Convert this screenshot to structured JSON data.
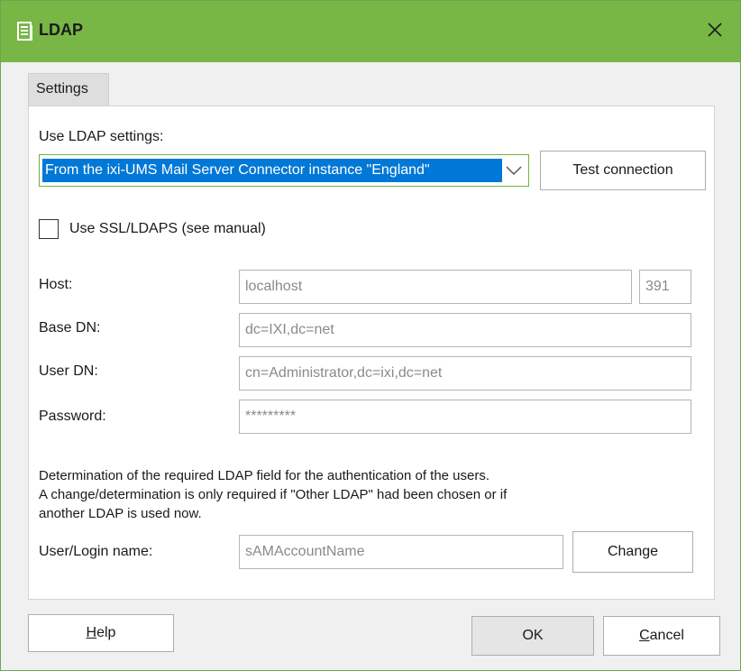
{
  "window": {
    "title": "LDAP",
    "accent": "#78b646"
  },
  "tabs": [
    {
      "label": "Settings",
      "active": true
    }
  ],
  "settings": {
    "use_ldap_label": "Use LDAP settings:",
    "ldap_source_value": "From the ixi-UMS Mail Server Connector instance \"England\"",
    "test_connection_label": "Test connection",
    "ssl_checkbox_label": "Use SSL/LDAPS (see manual)",
    "ssl_checked": false,
    "host_label": "Host:",
    "host_value": "localhost",
    "port_value": "391",
    "base_dn_label": "Base DN:",
    "base_dn_value": "dc=IXI,dc=net",
    "user_dn_label": "User DN:",
    "user_dn_value": "cn=Administrator,dc=ixi,dc=net",
    "password_label": "Password:",
    "password_value": "*********",
    "info_line1": "Determination of the required LDAP field for the authentication of the users.",
    "info_line2": "A change/determination is only required if \"Other LDAP\" had been chosen or if",
    "info_line3": "another LDAP is used now.",
    "login_label": "User/Login name:",
    "login_value": "sAMAccountName",
    "change_label": "Change"
  },
  "footer": {
    "help_rest": "elp",
    "help_accel": "H",
    "ok_label": "OK",
    "cancel_accel": "C",
    "cancel_rest": "ancel"
  },
  "icons": {
    "app": "document-list-icon",
    "close": "close-icon",
    "dropdown": "chevron-down-icon"
  }
}
